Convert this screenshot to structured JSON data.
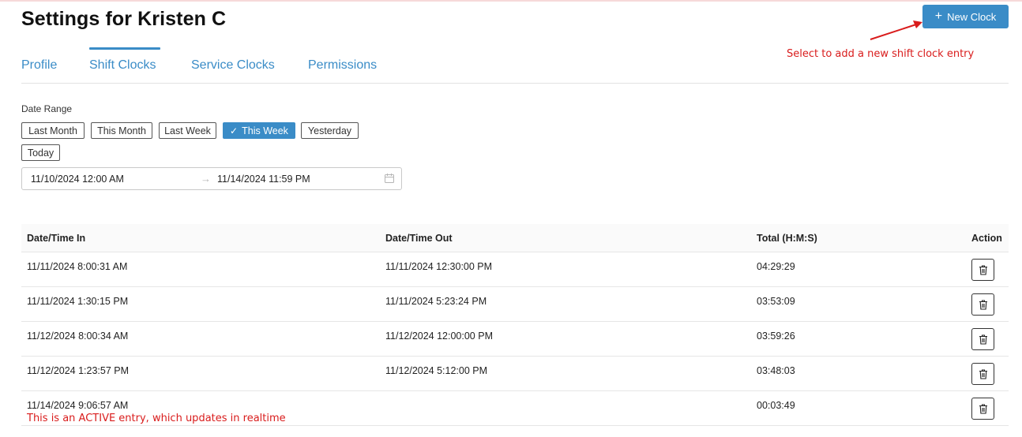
{
  "page": {
    "title": "Settings for Kristen C"
  },
  "header": {
    "new_clock_label": "New Clock",
    "annotation": "Select to add a new shift clock entry"
  },
  "tabs": [
    {
      "label": "Profile",
      "active": false
    },
    {
      "label": "Shift Clocks",
      "active": true
    },
    {
      "label": "Service Clocks",
      "active": false
    },
    {
      "label": "Permissions",
      "active": false
    }
  ],
  "date_range": {
    "label": "Date Range",
    "presets": [
      {
        "label": "Last Month",
        "active": false
      },
      {
        "label": "This Month",
        "active": false
      },
      {
        "label": "Last Week",
        "active": false
      },
      {
        "label": "This Week",
        "active": true
      },
      {
        "label": "Yesterday",
        "active": false
      },
      {
        "label": "Today",
        "active": false
      }
    ],
    "start": "11/10/2024 12:00 AM",
    "end": "11/14/2024 11:59 PM",
    "separator_icon": "arrow-right-icon",
    "calendar_icon": "calendar-icon"
  },
  "table": {
    "headers": [
      "Date/Time In",
      "Date/Time Out",
      "Total (H:M:S)",
      "Action"
    ],
    "rows": [
      {
        "time_in": "11/11/2024 8:00:31 AM",
        "time_out": "11/11/2024 12:30:00 PM",
        "total": "04:29:29"
      },
      {
        "time_in": "11/11/2024 1:30:15 PM",
        "time_out": "11/11/2024 5:23:24 PM",
        "total": "03:53:09"
      },
      {
        "time_in": "11/12/2024 8:00:34 AM",
        "time_out": "11/12/2024 12:00:00 PM",
        "total": "03:59:26"
      },
      {
        "time_in": "11/12/2024 1:23:57 PM",
        "time_out": "11/12/2024 5:12:00 PM",
        "total": "03:48:03"
      },
      {
        "time_in": "11/14/2024 9:06:57 AM",
        "time_out": "",
        "total": "00:03:49",
        "note": "This is an ACTIVE entry, which updates in realtime"
      }
    ],
    "action_icon": "trash-icon"
  },
  "colors": {
    "accent": "#3a8cc7",
    "annotation": "#d91c1c"
  }
}
